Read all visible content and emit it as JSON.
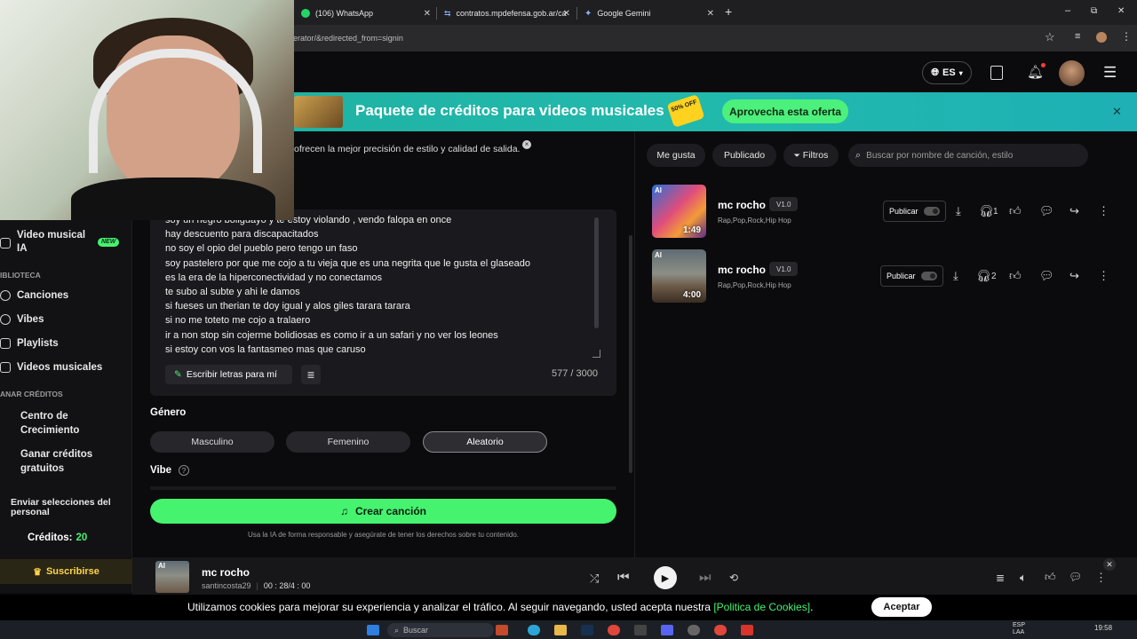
{
  "browser": {
    "tabs": [
      {
        "label": "(106) WhatsApp",
        "icon": "whatsapp-icon"
      },
      {
        "label": "contratos.mpdefensa.gob.ar/ca",
        "icon": "site-icon"
      },
      {
        "label": "Google Gemini",
        "icon": "gemini-icon"
      }
    ],
    "new_tab": "+",
    "url": "enerator/&redirected_from=signin",
    "win_min": "–",
    "win_restore": "⧉",
    "win_close": "✕"
  },
  "header": {
    "language": "ES"
  },
  "banner": {
    "title": "Paquete de créditos para videos musicales",
    "badge": "50% OFF",
    "cta": "Aprovecha esta oferta",
    "close": "✕"
  },
  "tooltip": "ofrecen la mejor precisión de estilo y calidad de salida.",
  "sidebar": {
    "video": "Video musical IA",
    "new_badge": "NEW",
    "library_label": "IBLIOTECA",
    "items": [
      "Canciones",
      "Vibes",
      "Playlists",
      "Videos musicales"
    ],
    "earn_label": "ANAR CRÉDITOS",
    "growth": "Centro de Crecimiento",
    "free": "Ganar créditos gratuitos",
    "send": "Enviar selecciones del personal",
    "credits_label": "Créditos:",
    "credits_value": "20",
    "subscribe": "Suscribirse"
  },
  "lyrics": {
    "lines": [
      "soy un negro boliguayo y te estoy violando , vendo falopa en once",
      "hay descuento para discapacitados",
      "no soy el opio del pueblo pero tengo un faso",
      "soy pastelero por que me cojo a tu vieja que  es una negrita que le gusta el glaseado",
      "es la era de la hiperconectividad y no conectamos",
      "te subo al subte y ahi le damos",
      " si fueses un therian te doy igual y alos giles tarara tarara",
      "si no me toteto me cojo a tralaero",
      "ir a non stop  sin cojerme bolidiosas es como ir a un safari y no ver los leones",
      "si estoy con vos la fantasmeo mas que caruso"
    ],
    "write_button": "Escribir letras para mí",
    "counter": "577 / 3000"
  },
  "genre": {
    "label": "Género",
    "options": [
      "Masculino",
      "Femenino",
      "Aleatorio"
    ],
    "selected": "Aleatorio"
  },
  "vibe_label": "Vibe",
  "create_button": "Crear canción",
  "disclaimer": "Usa la IA de forma responsable y asegúrate de tener los derechos sobre tu contenido.",
  "filters": {
    "chips": [
      "Me gusta",
      "Publicado",
      "Filtros"
    ],
    "search_placeholder": "Buscar por nombre de canción, estilo"
  },
  "songs": [
    {
      "title": "mc rocho",
      "version": "V1.0",
      "tags": "Rap,Pop,Rock,Hip Hop",
      "duration": "1:49",
      "publish": "Publicar",
      "listens": "1",
      "ai": "AI"
    },
    {
      "title": "mc rocho",
      "version": "V1.0",
      "tags": "Rap,Pop,Rock,Hip Hop",
      "duration": "4:00",
      "publish": "Publicar",
      "listens": "2",
      "ai": "AI"
    }
  ],
  "player": {
    "title": "mc rocho",
    "artist": "santincosta29",
    "time": "00 : 28/4 : 00",
    "ai": "AI",
    "close": "✕"
  },
  "cookie": {
    "text": "Utilizamos cookies para mejorar su experiencia y analizar el tráfico. Al seguir navegando, usted acepta nuestra",
    "link": "[Politica de Cookies]",
    "dot": ".",
    "accept": "Aceptar"
  },
  "taskbar": {
    "search": "Buscar",
    "lang_top": "ESP",
    "lang_bottom": "LAA",
    "time": "19:58"
  }
}
